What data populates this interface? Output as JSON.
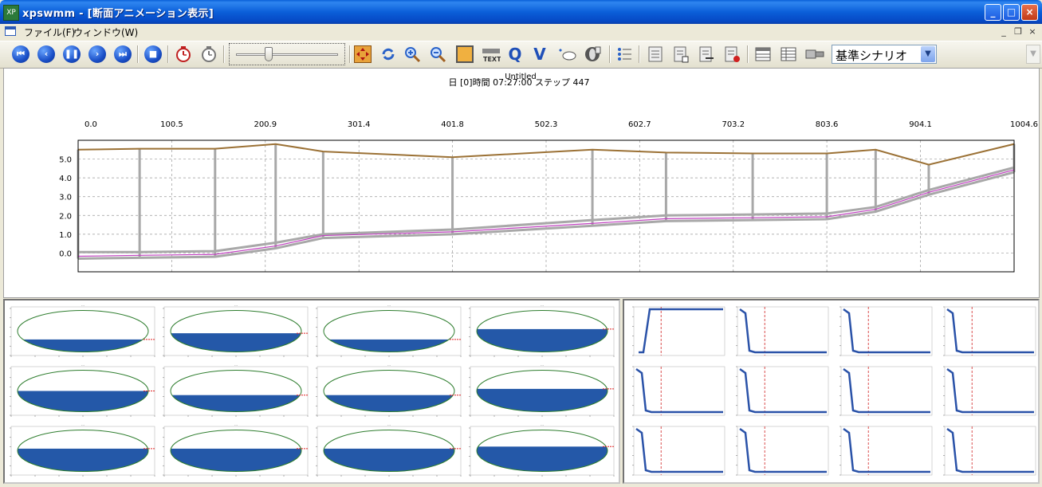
{
  "window": {
    "icon_label": "XP",
    "title": "xpswmm - [断面アニメーション表示]",
    "minimize_label": "_",
    "maximize_label": "□",
    "close_label": "×"
  },
  "menu": {
    "items": [
      "ファイル(F)",
      "ウィンドウ(W)"
    ],
    "mdi_minimize": "_",
    "mdi_restore": "❐",
    "mdi_close": "×"
  },
  "toolbar": {
    "scenario_value": "基準シナリオ",
    "playback_labels": [
      "skip-to-start",
      "step-back",
      "pause",
      "step-forward",
      "skip-to-end",
      "stop"
    ],
    "text_tool_label": "TEXT",
    "q_tool_label": "Q",
    "v_tool_label": "V"
  },
  "profile": {
    "title": "Untitled",
    "status": "日 [0]時間 07:27:00 ステップ 447",
    "x_ticks": [
      "0.0",
      "100.5",
      "200.9",
      "301.4",
      "401.8",
      "502.3",
      "602.7",
      "703.2",
      "803.6",
      "904.1",
      "1004.6"
    ],
    "y_ticks": [
      "0.0",
      "1.0",
      "2.0",
      "3.0",
      "4.0",
      "5.0"
    ],
    "colors": {
      "ground": "#9b7135",
      "pipe": "#a8a8a8",
      "water": "#c040c0",
      "grid": "#999999"
    }
  },
  "chart_data": [
    {
      "type": "line",
      "title": "Untitled",
      "xlabel": "",
      "ylabel": "",
      "xlim": [
        0,
        1004.6
      ],
      "ylim": [
        -1.0,
        6.0
      ],
      "series": [
        {
          "x": [
            0,
            66,
            147,
            212,
            263,
            401.8,
            552,
            631,
            724,
            803.6,
            856,
            913,
            1004.6
          ],
          "values": [
            5.5,
            5.55,
            5.55,
            5.8,
            5.4,
            5.1,
            5.5,
            5.35,
            5.3,
            5.3,
            5.5,
            4.7,
            5.8
          ]
        },
        {
          "x": [
            0,
            66,
            147,
            212,
            263,
            401.8,
            552,
            631,
            724,
            803.6,
            856,
            913,
            1004.6
          ],
          "values": [
            0.05,
            0.05,
            0.1,
            0.55,
            1.0,
            1.25,
            1.75,
            2.0,
            2.05,
            2.1,
            2.45,
            3.35,
            4.55
          ]
        },
        {
          "x": [
            0,
            66,
            147,
            212,
            263,
            401.8,
            552,
            631,
            724,
            803.6,
            856,
            913,
            1004.6
          ],
          "values": [
            -0.3,
            -0.25,
            -0.2,
            0.25,
            0.8,
            1.0,
            1.45,
            1.7,
            1.75,
            1.8,
            2.2,
            3.1,
            4.3
          ]
        }
      ]
    }
  ],
  "sections": [
    {
      "title": "...",
      "fill": 0.3,
      "level_label": ""
    },
    {
      "title": "...",
      "fill": 0.45,
      "level_label": ""
    },
    {
      "title": "...",
      "fill": 0.3,
      "level_label": ""
    },
    {
      "title": "...",
      "fill": 0.55,
      "level_label": ""
    },
    {
      "title": "...",
      "fill": 0.5,
      "level_label": ""
    },
    {
      "title": "...",
      "fill": 0.4,
      "level_label": ""
    },
    {
      "title": "...",
      "fill": 0.4,
      "level_label": ""
    },
    {
      "title": "...",
      "fill": 0.55,
      "level_label": ""
    },
    {
      "title": "...",
      "fill": 0.55,
      "level_label": ""
    },
    {
      "title": "...",
      "fill": 0.55,
      "level_label": ""
    },
    {
      "title": "...",
      "fill": 0.55,
      "level_label": ""
    },
    {
      "title": "...",
      "fill": 0.6,
      "level_label": ""
    }
  ],
  "hydrographs": [
    {
      "shape": "rise"
    },
    {
      "shape": "fall"
    },
    {
      "shape": "fall"
    },
    {
      "shape": "fall"
    },
    {
      "shape": "fall"
    },
    {
      "shape": "fall"
    },
    {
      "shape": "fall"
    },
    {
      "shape": "fall"
    },
    {
      "shape": "fall"
    },
    {
      "shape": "fall"
    },
    {
      "shape": "fall"
    },
    {
      "shape": "fall"
    }
  ],
  "small_panel_colors": {
    "ellipse": "#2e7d2e",
    "water": "#2458a8",
    "level": "#e02020",
    "line": "#2a52a8",
    "marker": "#d02020"
  }
}
